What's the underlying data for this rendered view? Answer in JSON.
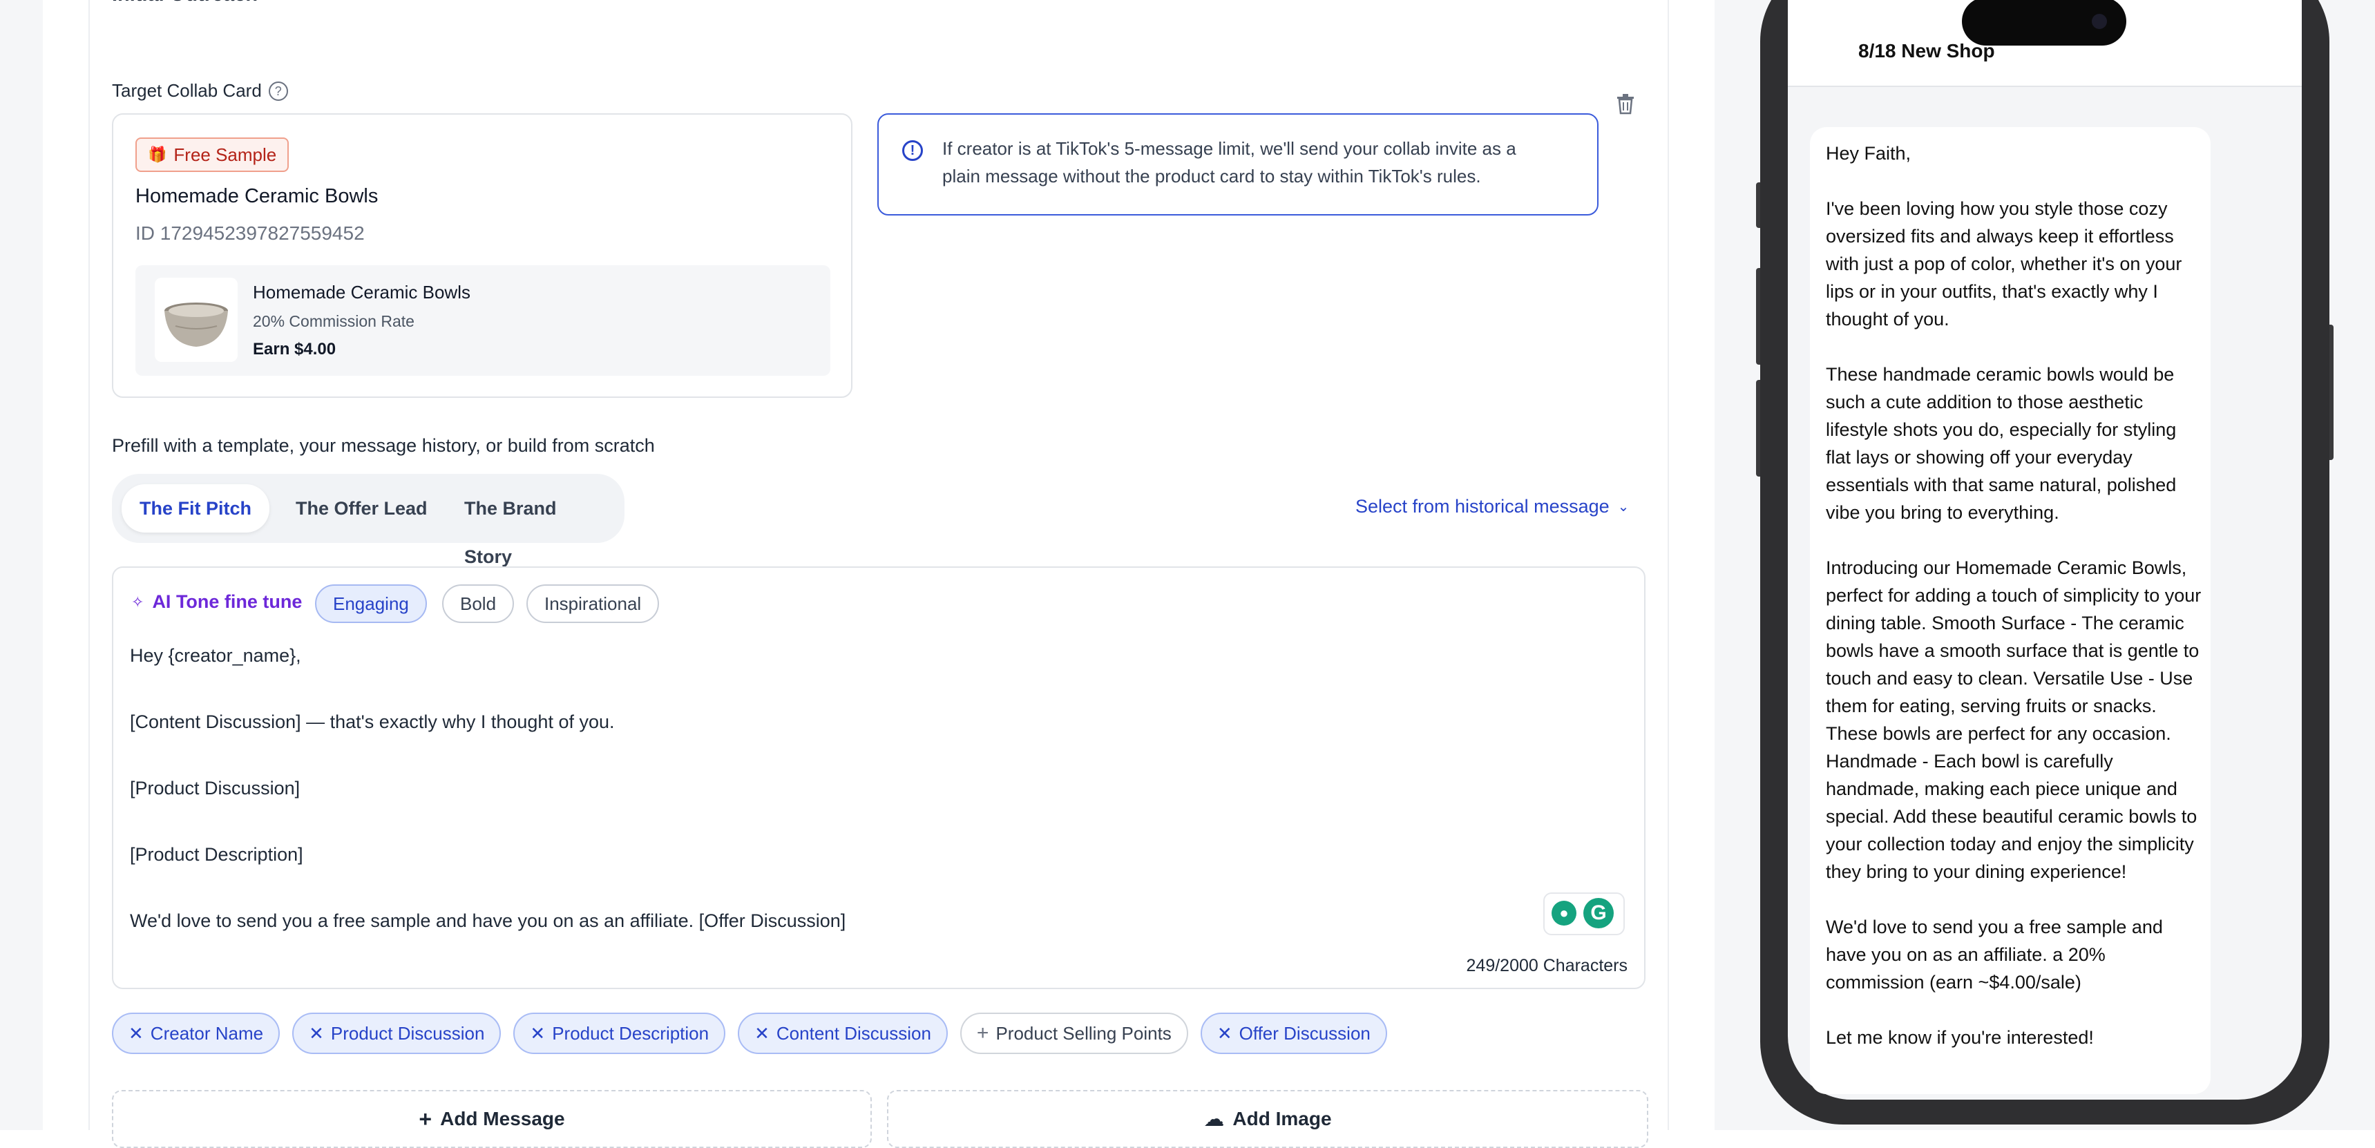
{
  "section_title": "Initial Outreach",
  "target_card": {
    "label": "Target Collab Card",
    "badge": "Free Sample",
    "product_name": "Homemade Ceramic Bowls",
    "product_id": "ID 1729452397827559452",
    "mini_name": "Homemade Ceramic Bowls",
    "mini_commission": "20% Commission Rate",
    "mini_earn": "Earn $4.00"
  },
  "notice": {
    "line1": "If creator is at TikTok's 5-message limit, we'll send your collab invite as a",
    "line2": "plain message without the product card to stay within TikTok's rules."
  },
  "prefill_label": "Prefill with a template, your message history, or build from scratch",
  "templates": [
    {
      "label": "The Fit Pitch",
      "active": true
    },
    {
      "label": "The Offer Lead",
      "active": false
    },
    {
      "label": "The Brand Story",
      "active": false
    }
  ],
  "historical_link": "Select from historical message",
  "editor": {
    "ai_label": "AI Tone fine tune",
    "tones": [
      "Engaging",
      "Bold",
      "Inspirational"
    ],
    "lines": [
      "Hey {creator_name},",
      "[Content Discussion] — that's exactly why I thought of you.",
      "[Product Discussion]",
      "[Product Description]",
      "We'd love to send you a free sample and have you on as an affiliate. [Offer Discussion]"
    ],
    "char_count": "249/2000 Characters"
  },
  "variables": [
    {
      "label": "Creator Name",
      "selected": true
    },
    {
      "label": "Product Discussion",
      "selected": true
    },
    {
      "label": "Product Description",
      "selected": true
    },
    {
      "label": "Content Discussion",
      "selected": true
    },
    {
      "label": "Product Selling Points",
      "selected": false
    },
    {
      "label": "Offer Discussion",
      "selected": true
    }
  ],
  "buttons": {
    "add_message": "Add Message",
    "add_image": "Add Image"
  },
  "phone": {
    "shop_name": "8/18 New Shop",
    "message": "Hey Faith,\n\nI've been loving how you style those cozy oversized fits and always keep it effortless with just a pop of color, whether it's on your lips or in your outfits, that's exactly why I thought of you.\n\nThese handmade ceramic bowls would be such a cute addition to those aesthetic lifestyle shots you do, especially for styling flat lays or showing off your everyday essentials with that same natural, polished vibe you bring to everything.\n\nIntroducing our Homemade Ceramic Bowls, perfect for adding a touch of simplicity to your dining table. Smooth Surface - The ceramic bowls have a smooth surface that is gentle to touch and easy to clean. Versatile Use - Use them for eating, serving fruits or snacks. These bowls are perfect for any occasion. Handmade - Each bowl is carefully handmade, making each piece unique and special. Add these beautiful ceramic bowls to your collection today and enjoy the simplicity they bring to your dining experience!\n\nWe'd love to send you a free sample and have you on as an affiliate. a 20% commission (earn ~$4.00/sale)\n\nLet me know if you're interested!"
  },
  "colors": {
    "accent": "#2743c8",
    "badge_red": "#c2410c",
    "ai_purple": "#6d28d9"
  }
}
